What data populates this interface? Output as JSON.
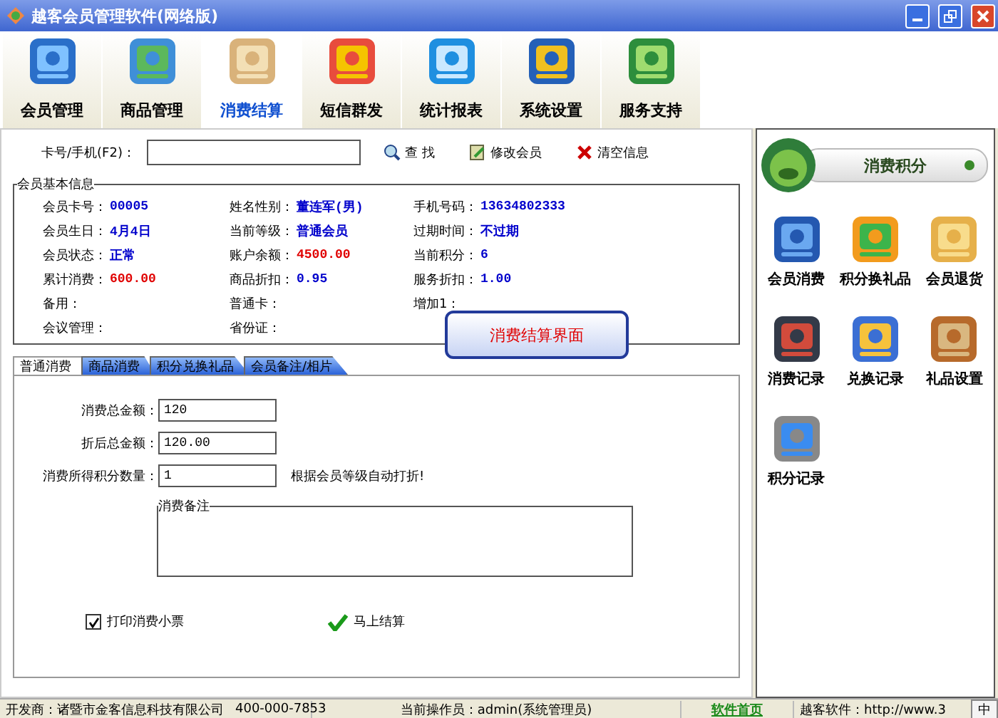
{
  "window": {
    "title": "越客会员管理软件(网络版)"
  },
  "toolbar": [
    {
      "label": "会员管理",
      "selected": false
    },
    {
      "label": "商品管理",
      "selected": false
    },
    {
      "label": "消费结算",
      "selected": true
    },
    {
      "label": "短信群发",
      "selected": false
    },
    {
      "label": "统计报表",
      "selected": false
    },
    {
      "label": "系统设置",
      "selected": false
    },
    {
      "label": "服务支持",
      "selected": false
    }
  ],
  "search": {
    "label": "卡号/手机(F2)：",
    "buttons": [
      "查 找",
      "修改会员",
      "清空信息"
    ]
  },
  "member_info": {
    "title": "会员基本信息",
    "fields": [
      {
        "label": "会员卡号：",
        "value": "00005",
        "color": "#0000cc"
      },
      {
        "label": "姓名性别：",
        "value": "董连军(男)",
        "color": "#0000cc"
      },
      {
        "label": "手机号码：",
        "value": "13634802333",
        "color": "#0000cc"
      },
      {
        "label": "会员生日：",
        "value": "4月4日",
        "color": "#0000cc"
      },
      {
        "label": "当前等级：",
        "value": "普通会员",
        "color": "#0000cc"
      },
      {
        "label": "过期时间：",
        "value": "不过期",
        "color": "#0000cc"
      },
      {
        "label": "会员状态：",
        "value": "正常",
        "color": "#0000cc"
      },
      {
        "label": "账户余额：",
        "value": "4500.00",
        "color": "#e00000"
      },
      {
        "label": "当前积分：",
        "value": "6",
        "color": "#0000cc"
      },
      {
        "label": "累计消费：",
        "value": "600.00",
        "color": "#e00000"
      },
      {
        "label": "商品折扣：",
        "value": "0.95",
        "color": "#0000cc"
      },
      {
        "label": "服务折扣：",
        "value": "1.00",
        "color": "#0000cc"
      },
      {
        "label": "备用："
      },
      {
        "label": "普通卡："
      },
      {
        "label": "增加1："
      },
      {
        "label": "会议管理："
      },
      {
        "label": "省份证："
      }
    ]
  },
  "sub_tabs": [
    {
      "label": "普通消费",
      "selected": true
    },
    {
      "label": "商品消费",
      "selected": false
    },
    {
      "label": "积分兑换礼品",
      "selected": false
    },
    {
      "label": "会员备注/相片",
      "selected": false
    }
  ],
  "form": {
    "fields": [
      {
        "label": "消费总金额：",
        "value": "120"
      },
      {
        "label": "折后总金额：",
        "value": "120.00"
      },
      {
        "label": "消费所得积分数量：",
        "value": "1"
      }
    ],
    "hint": "根据会员等级自动打折!",
    "notes_title": "消费备注",
    "print_receipt": {
      "label": "打印消费小票",
      "checked": true
    },
    "settle_button": "马上结算"
  },
  "callout": "消费结算界面",
  "side_panel": {
    "title": "消费积分",
    "items": [
      {
        "label": "会员消费"
      },
      {
        "label": "积分换礼品"
      },
      {
        "label": "会员退货"
      },
      {
        "label": "消费记录"
      },
      {
        "label": "兑换记录"
      },
      {
        "label": "礼品设置"
      },
      {
        "label": "积分记录"
      }
    ]
  },
  "status_bar": {
    "developer": "开发商：诸暨市金客信息科技有限公司",
    "phone": "400-000-7853",
    "operator": "当前操作员：admin(系统管理员)",
    "home_link": "软件首页",
    "website": "越客软件：http://www.3",
    "ime": "中"
  }
}
